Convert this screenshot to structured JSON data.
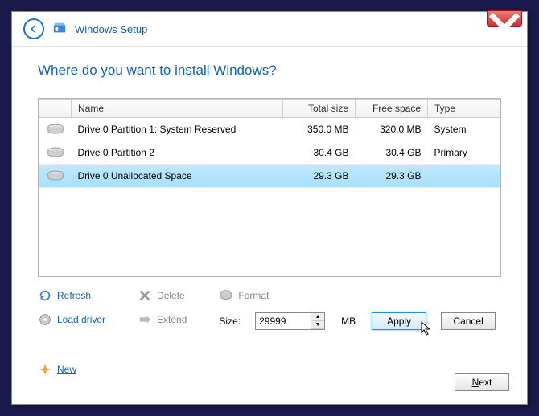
{
  "window": {
    "title": "Windows Setup"
  },
  "heading": "Where do you want to install Windows?",
  "columns": {
    "name": "Name",
    "total": "Total size",
    "free": "Free space",
    "type": "Type"
  },
  "rows": [
    {
      "name": "Drive 0 Partition 1: System Reserved",
      "total": "350.0 MB",
      "free": "320.0 MB",
      "type": "System",
      "selected": false
    },
    {
      "name": "Drive 0 Partition 2",
      "total": "30.4 GB",
      "free": "30.4 GB",
      "type": "Primary",
      "selected": false
    },
    {
      "name": "Drive 0 Unallocated Space",
      "total": "29.3 GB",
      "free": "29.3 GB",
      "type": "",
      "selected": true
    }
  ],
  "actions": {
    "refresh": "Refresh",
    "load_driver": "Load driver",
    "delete": "Delete",
    "extend": "Extend",
    "format": "Format",
    "new": "New"
  },
  "size": {
    "label": "Size:",
    "value": "29999",
    "unit": "MB"
  },
  "buttons": {
    "apply": "Apply",
    "cancel": "Cancel",
    "next": "Next"
  }
}
